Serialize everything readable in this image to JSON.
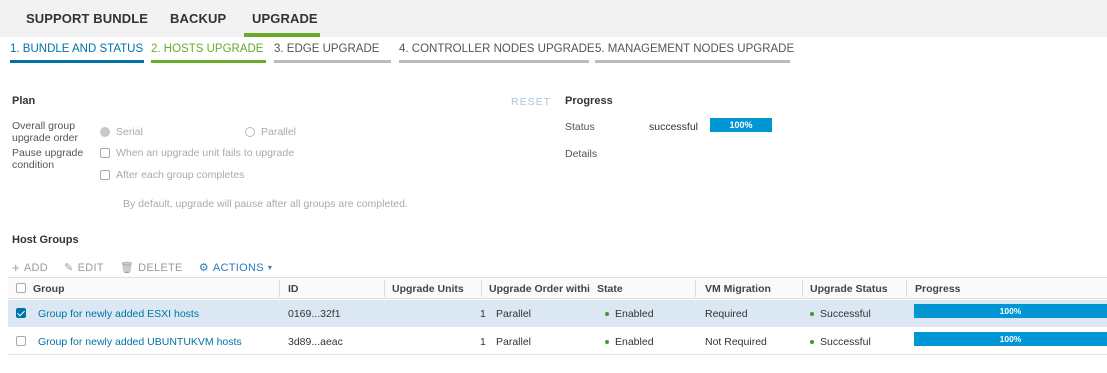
{
  "top_tabs": [
    "SUPPORT BUNDLE",
    "BACKUP",
    "UPGRADE"
  ],
  "steps": [
    "1. BUNDLE AND STATUS",
    "2. HOSTS UPGRADE",
    "3. EDGE UPGRADE",
    "4. CONTROLLER NODES UPGRADE",
    "5. MANAGEMENT NODES UPGRADE"
  ],
  "plan": {
    "title": "Plan",
    "reset": "RESET",
    "order_label": "Overall group upgrade order",
    "order_serial": "Serial",
    "order_parallel": "Parallel",
    "pause_label": "Pause upgrade condition",
    "pause_fail": "When an upgrade unit fails to upgrade",
    "pause_group": "After each group completes",
    "note": "By default, upgrade will pause after all groups are completed."
  },
  "progress": {
    "title": "Progress",
    "status_label": "Status",
    "status_value": "successful",
    "percent": "100%",
    "details_label": "Details"
  },
  "host_groups": {
    "title": "Host Groups",
    "toolbar": {
      "add": "ADD",
      "edit": "EDIT",
      "delete": "DELETE",
      "actions": "ACTIONS"
    },
    "columns": [
      "Group",
      "ID",
      "Upgrade Units",
      "Upgrade Order withi",
      "State",
      "VM Migration",
      "Upgrade Status",
      "Progress"
    ],
    "rows": [
      {
        "selected": true,
        "group": "Group for newly added ESXI hosts",
        "id": "0169...32f1",
        "units": "1",
        "order": "Parallel",
        "state": "Enabled",
        "vm_migration": "Required",
        "status": "Successful",
        "progress": "100%"
      },
      {
        "selected": false,
        "group": "Group for newly added UBUNTUKVM hosts",
        "id": "3d89...aeac",
        "units": "1",
        "order": "Parallel",
        "state": "Enabled",
        "vm_migration": "Not Required",
        "status": "Successful",
        "progress": "100%"
      }
    ]
  },
  "colors": {
    "primary": "#0072a3",
    "accent_green": "#6aaa2a",
    "progress_blue": "#0095d3"
  }
}
